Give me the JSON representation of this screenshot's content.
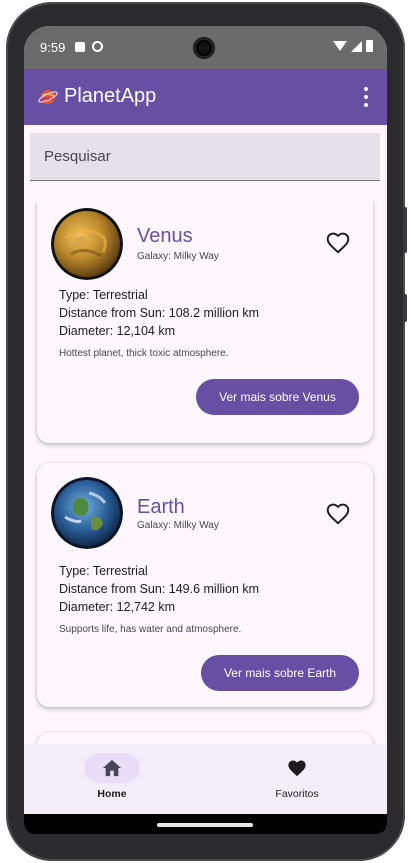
{
  "status": {
    "time": "9:59"
  },
  "app": {
    "title": "PlanetApp"
  },
  "search": {
    "placeholder": "Pesquisar",
    "value": ""
  },
  "planets": [
    {
      "name": "Venus",
      "galaxy": "Galaxy: Milky Way",
      "type": "Type: Terrestrial",
      "distance": "Distance from Sun: 108.2 million km",
      "diameter": "Diameter: 12,104 km",
      "description": "Hottest planet, thick toxic atmosphere.",
      "button_label": "Ver mais sobre Venus",
      "favorite": false
    },
    {
      "name": "Earth",
      "galaxy": "Galaxy: Milky Way",
      "type": "Type: Terrestrial",
      "distance": "Distance from Sun: 149.6 million km",
      "diameter": "Diameter: 12,742 km",
      "description": "Supports life, has water and atmosphere.",
      "button_label": "Ver mais sobre Earth",
      "favorite": false
    }
  ],
  "nav": {
    "items": [
      {
        "label": "Home",
        "icon": "home-icon",
        "active": true
      },
      {
        "label": "Favoritos",
        "icon": "heart-icon",
        "active": false
      }
    ]
  },
  "colors": {
    "primary": "#6750a4",
    "surface": "#fdf7fd",
    "nav_bg": "#f3edf7",
    "active_pill": "#e8def8"
  }
}
